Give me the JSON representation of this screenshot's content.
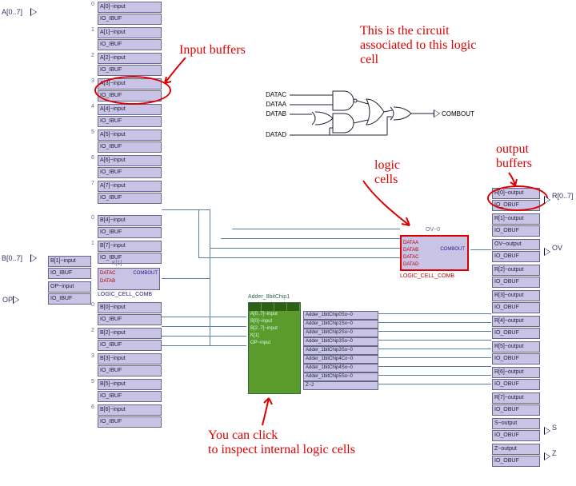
{
  "ports": {
    "A": "A[0..7]",
    "B": "B[0..7]",
    "OP": "OP",
    "R": "R[0..7]",
    "OV": "OV",
    "S": "S",
    "Z": "Z"
  },
  "ibufA": [
    {
      "top": "A[0]~input",
      "bot": "IO_IBUF"
    },
    {
      "top": "A[1]~input",
      "bot": "IO_IBUF"
    },
    {
      "top": "A[2]~input",
      "bot": "IO_IBUF"
    },
    {
      "top": "A[3]~input",
      "bot": "IO_IBUF"
    },
    {
      "top": "A[4]~input",
      "bot": "IO_IBUF"
    },
    {
      "top": "A[5]~input",
      "bot": "IO_IBUF"
    },
    {
      "top": "A[6]~input",
      "bot": "IO_IBUF"
    },
    {
      "top": "A[7]~input",
      "bot": "IO_IBUF"
    }
  ],
  "ibufB_sidecol": [
    {
      "top": "B[1]~input",
      "bot": "IO_IBUF"
    },
    {
      "top": "OP~input",
      "bot": "IO_IBUF"
    }
  ],
  "ibufB": [
    {
      "top": "B[4]~input",
      "bot": "IO_IBUF"
    },
    {
      "top": "B[7]~input",
      "bot": "IO_IBUF"
    },
    {
      "top": "K[1]",
      "bot": ""
    },
    {
      "top": "B[0]~input",
      "bot": "IO_IBUF"
    },
    {
      "top": "B[2]~input",
      "bot": "IO_IBUF"
    },
    {
      "top": "B[3]~input",
      "bot": "IO_IBUF"
    },
    {
      "top": "B[5]~input",
      "bot": "IO_IBUF"
    },
    {
      "top": "B[6]~input",
      "bot": "IO_IBUF"
    }
  ],
  "logic_cell_k1": {
    "pins_left": [
      "DATAC",
      "DATAB"
    ],
    "pin_right": "COMBOUT",
    "label": "LOGIC_CELL_COMB"
  },
  "logic_cell_ov": {
    "toplabel": "OV~0",
    "pins_left": [
      "DATAA",
      "DATAB",
      "DATAC",
      "DATAD"
    ],
    "pin_right": "COMBOUT",
    "label": "LOGIC_CELL_COMB"
  },
  "adder": {
    "title": "Adder_8bitChip1",
    "inputs": [
      "A[0..7]~input",
      "B[0]~input",
      "B[2..7]~input",
      "K[1]",
      "OP~input"
    ],
    "outputs": [
      "Adder_1bitChip0So~0",
      "Adder_1bitChip1So~0",
      "Adder_1bitChip2So~0",
      "Adder_1bitChip3So~0",
      "Adder_1bitChip3So~0",
      "Adder_1bitChip4Co~0",
      "Adder_1bitChip4So~0",
      "Adder_1bitChip5So~0",
      "Z~2"
    ]
  },
  "obuf": [
    {
      "top": "R[0]~output",
      "bot": "IO_OBUF"
    },
    {
      "top": "R[1]~output",
      "bot": "IO_OBUF"
    },
    {
      "top": "OV~output",
      "bot": "IO_OBUF"
    },
    {
      "top": "R[2]~output",
      "bot": "IO_OBUF"
    },
    {
      "top": "R[3]~output",
      "bot": "IO_OBUF"
    },
    {
      "top": "R[4]~output",
      "bot": "IO_OBUF"
    },
    {
      "top": "R[5]~output",
      "bot": "IO_OBUF"
    },
    {
      "top": "R[6]~output",
      "bot": "IO_OBUF"
    },
    {
      "top": "R[7]~output",
      "bot": "IO_OBUF"
    },
    {
      "top": "S~output",
      "bot": "IO_OBUF"
    },
    {
      "top": "Z~output",
      "bot": "IO_OBUF"
    }
  ],
  "gate_inputs": [
    "DATAC",
    "DATAA",
    "DATAB",
    "DATAD"
  ],
  "gate_output": "COMBOUT",
  "annot": {
    "input_buffers": "Input buffers",
    "main": "This is the circuit\nassociated to this logic\ncell",
    "logic_cells": "logic\ncells",
    "output_buffers": "output\nbuffers",
    "click": "You can click\nto inspect internal logic cells"
  }
}
